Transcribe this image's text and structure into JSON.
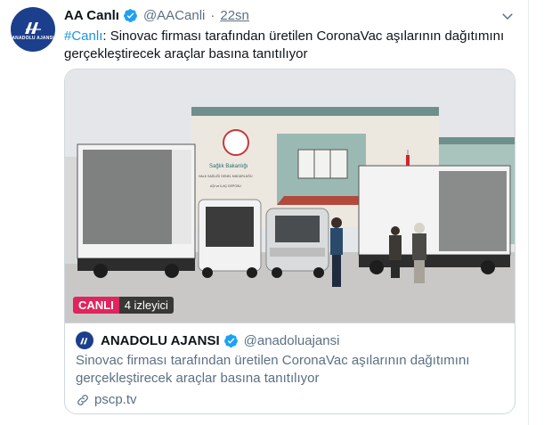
{
  "tweet": {
    "author_name": "AA Canlı",
    "author_handle": "@AACanli",
    "separator": "·",
    "time": "22sn",
    "hashtag": "#Canlı",
    "text": ": Sinovac firması tarafından üretilen CoronaVac aşılarının dağıtımını gerçekleştirecek araçlar basına tanıtılıyor"
  },
  "avatar": {
    "logo_text": "ANADOLU AJANSI"
  },
  "media": {
    "live_label": "CANLI",
    "viewers": "4 izleyici",
    "building_sign_1": "Sağlık Bakanlığı",
    "building_sign_2": "HALK SAĞLIĞI GENEL MÜDÜRLÜĞÜ",
    "building_sign_3": "AŞI ve İLAÇ DEPOSU"
  },
  "card": {
    "name": "ANADOLU AJANSI",
    "handle": "@anadoluajansi",
    "description": "Sinovac firması tarafından üretilen CoronaVac aşılarının dağıtımını gerçekleştirecek araçlar basına tanıtılıyor",
    "link": "pscp.tv"
  },
  "colors": {
    "accent": "#1b95e0",
    "verified": "#1da1f2",
    "live": "#e0245e",
    "brand": "#1b3f8c"
  },
  "icons": [
    "verified-badge-icon",
    "caret-down-icon",
    "link-icon",
    "aa-logo-icon"
  ]
}
